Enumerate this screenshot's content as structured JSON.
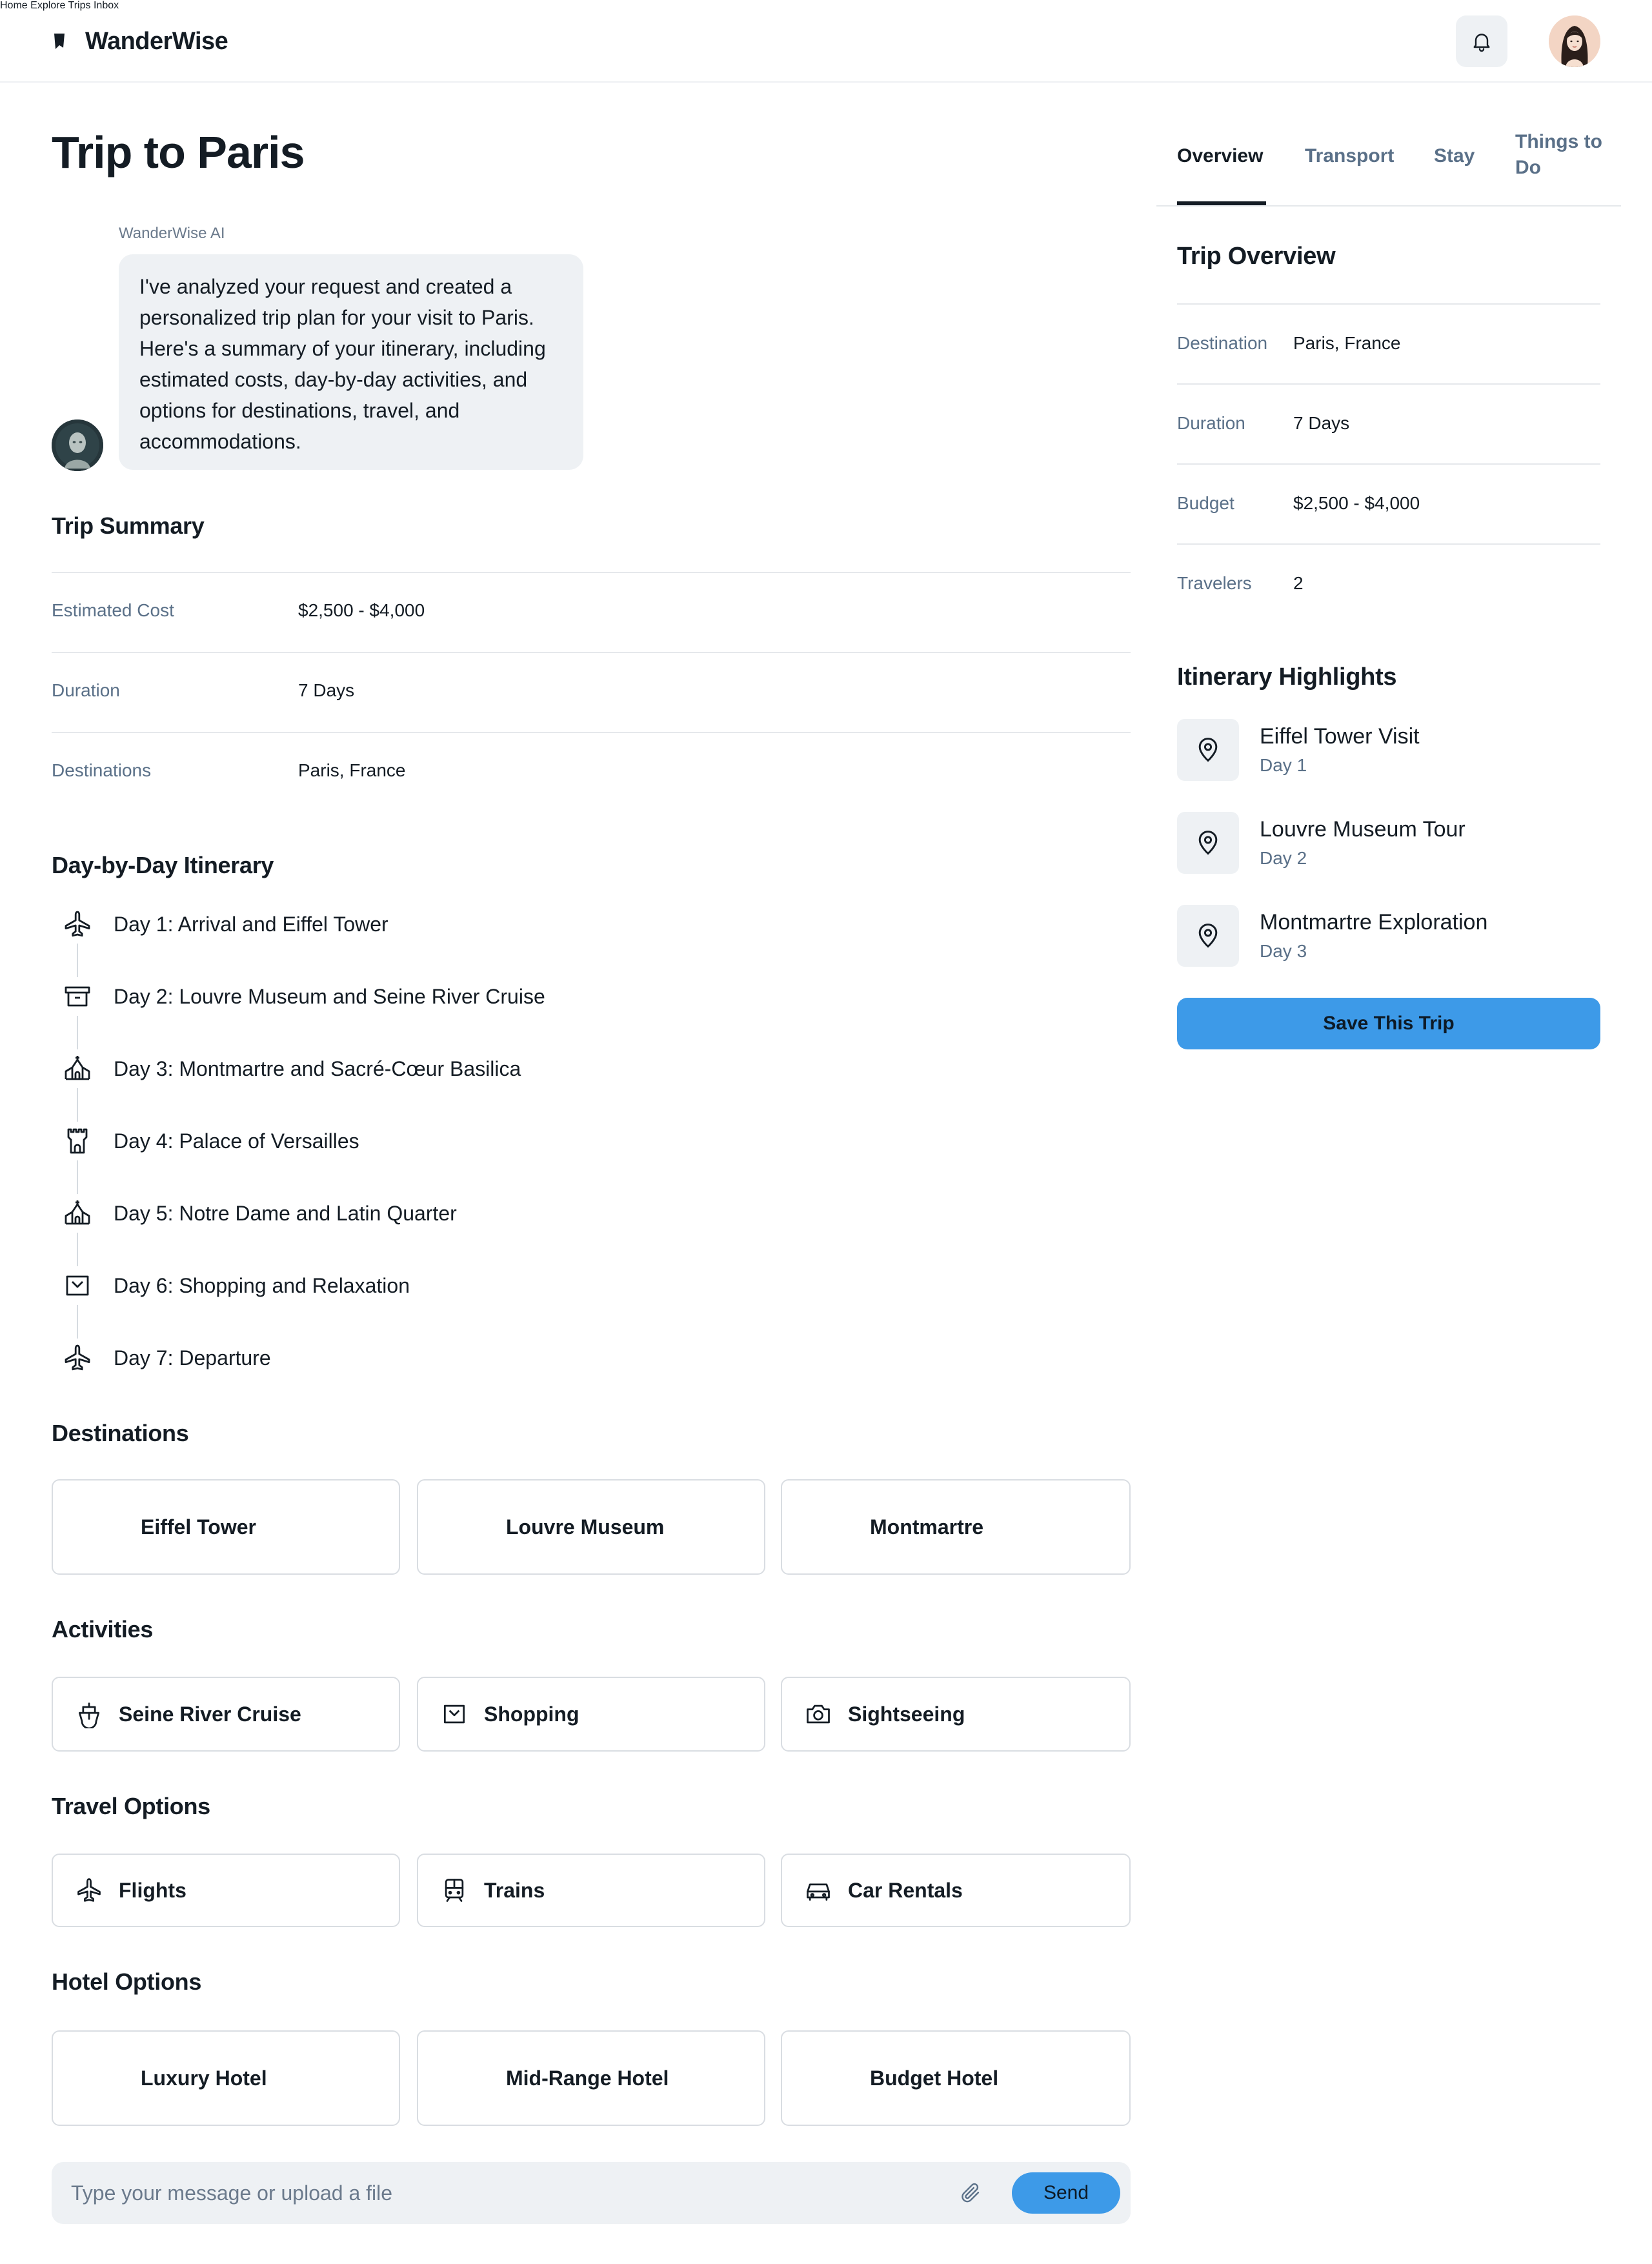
{
  "app": {
    "name": "WanderWise"
  },
  "nav": {
    "home": "Home",
    "explore": "Explore",
    "trips": "Trips",
    "inbox": "Inbox"
  },
  "page": {
    "title": "Trip to Paris"
  },
  "ai_message": {
    "sender": "WanderWise AI",
    "text": "I've analyzed your request and created a personalized trip plan for your visit to Paris. Here's a summary of your itinerary, including estimated costs, day-by-day activities, and options for destinations, travel, and accommodations."
  },
  "trip_summary": {
    "title": "Trip Summary",
    "rows": [
      {
        "label": "Estimated Cost",
        "value": "$2,500 - $4,000"
      },
      {
        "label": "Duration",
        "value": "7 Days"
      },
      {
        "label": "Destinations",
        "value": "Paris, France"
      }
    ]
  },
  "itinerary": {
    "title": "Day-by-Day Itinerary",
    "days": [
      {
        "text": "Day 1: Arrival and Eiffel Tower",
        "icon": "plane-icon"
      },
      {
        "text": "Day 2: Louvre Museum and Seine River Cruise",
        "icon": "archive-icon"
      },
      {
        "text": "Day 3: Montmartre and Sacré-Cœur Basilica",
        "icon": "church-icon"
      },
      {
        "text": "Day 4: Palace of Versailles",
        "icon": "castle-icon"
      },
      {
        "text": "Day 5: Notre Dame and Latin Quarter",
        "icon": "church-icon"
      },
      {
        "text": "Day 6: Shopping and Relaxation",
        "icon": "shopping-bag-icon"
      },
      {
        "text": "Day 7: Departure",
        "icon": "plane-icon"
      }
    ]
  },
  "destinations": {
    "title": "Destinations",
    "items": [
      "Eiffel Tower",
      "Louvre Museum",
      "Montmartre"
    ]
  },
  "activities": {
    "title": "Activities",
    "items": [
      {
        "label": "Seine River Cruise",
        "icon": "ship-icon"
      },
      {
        "label": "Shopping",
        "icon": "shopping-bag-icon"
      },
      {
        "label": "Sightseeing",
        "icon": "camera-icon"
      }
    ]
  },
  "travel_options": {
    "title": "Travel Options",
    "items": [
      {
        "label": "Flights",
        "icon": "plane-icon"
      },
      {
        "label": "Trains",
        "icon": "train-icon"
      },
      {
        "label": "Car Rentals",
        "icon": "car-icon"
      }
    ]
  },
  "hotel_options": {
    "title": "Hotel Options",
    "items": [
      "Luxury Hotel",
      "Mid-Range Hotel",
      "Budget Hotel"
    ]
  },
  "composer": {
    "placeholder": "Type your message or upload a file",
    "send_label": "Send"
  },
  "tabs": [
    "Overview",
    "Transport",
    "Stay",
    "Things to Do"
  ],
  "active_tab": "Overview",
  "overview": {
    "title": "Trip Overview",
    "rows": [
      {
        "label": "Destination",
        "value": "Paris, France"
      },
      {
        "label": "Duration",
        "value": "7 Days"
      },
      {
        "label": "Budget",
        "value": "$2,500 - $4,000"
      },
      {
        "label": "Travelers",
        "value": "2"
      }
    ]
  },
  "highlights": {
    "title": "Itinerary Highlights",
    "items": [
      {
        "name": "Eiffel Tower Visit",
        "day": "Day 1",
        "icon": "map-pin-icon"
      },
      {
        "name": "Louvre Museum Tour",
        "day": "Day 2",
        "icon": "map-pin-icon"
      },
      {
        "name": "Montmartre Exploration",
        "day": "Day 3",
        "icon": "map-pin-icon"
      }
    ]
  },
  "save_button": "Save This Trip",
  "colors": {
    "accent": "#3d9ae8",
    "muted_text": "#5a7088",
    "surface": "#eef1f4",
    "border": "#d9dde2"
  }
}
